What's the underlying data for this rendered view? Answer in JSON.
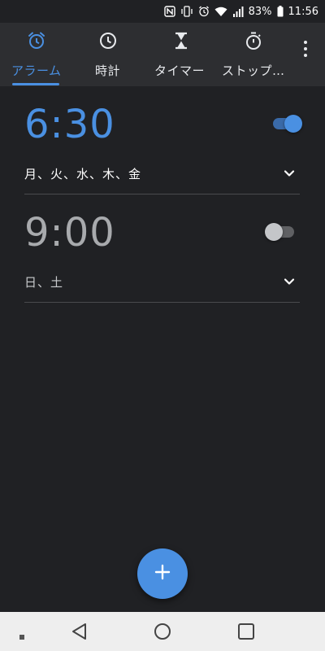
{
  "status_bar": {
    "battery_percent": "83%",
    "time": "11:56"
  },
  "tabs": [
    {
      "label": "アラーム",
      "icon": "alarm-icon",
      "active": true
    },
    {
      "label": "時計",
      "icon": "clock-icon",
      "active": false
    },
    {
      "label": "タイマー",
      "icon": "hourglass-icon",
      "active": false
    },
    {
      "label": "ストップ…",
      "icon": "stopwatch-icon",
      "active": false
    }
  ],
  "alarms": [
    {
      "time": "6:30",
      "days": "月、火、水、木、金",
      "enabled": true
    },
    {
      "time": "9:00",
      "days": "日、土",
      "enabled": false
    }
  ],
  "colors": {
    "accent": "#4a90e2",
    "background": "#202124",
    "header": "#2d2e31",
    "nav_bar": "#eeeeee"
  }
}
